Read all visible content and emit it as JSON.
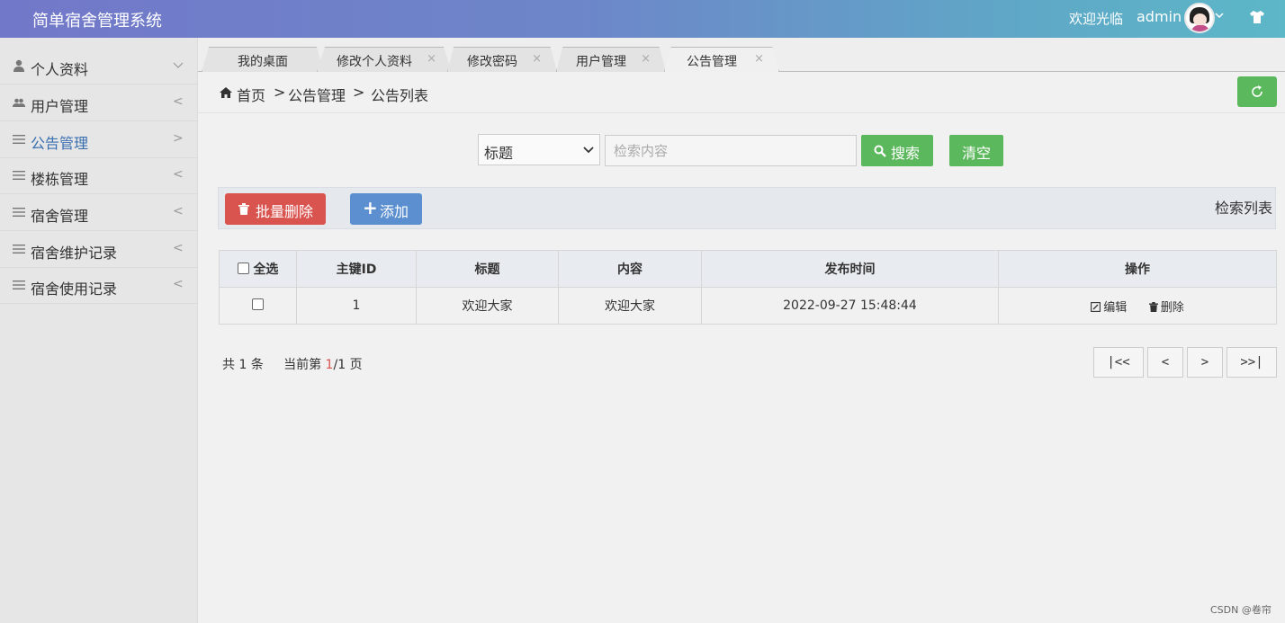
{
  "header": {
    "title": "简单宿舍管理系统",
    "welcome": "欢迎光临",
    "username": "admin"
  },
  "sidebar": {
    "items": [
      {
        "label": "个人资料",
        "arrow": "﹀",
        "icon": "user-icon"
      },
      {
        "label": "用户管理",
        "arrow": "<",
        "icon": "users-icon"
      },
      {
        "label": "公告管理",
        "arrow": ">",
        "icon": "list-icon",
        "active": true
      },
      {
        "label": "楼栋管理",
        "arrow": "<",
        "icon": "list-icon"
      },
      {
        "label": "宿舍管理",
        "arrow": "<",
        "icon": "list-icon"
      },
      {
        "label": "宿舍维护记录",
        "arrow": "<",
        "icon": "list-icon"
      },
      {
        "label": "宿舍使用记录",
        "arrow": "<",
        "icon": "list-icon"
      }
    ]
  },
  "tabs": [
    {
      "label": "我的桌面",
      "closable": false
    },
    {
      "label": "修改个人资料",
      "closable": true
    },
    {
      "label": "修改密码",
      "closable": true
    },
    {
      "label": "用户管理",
      "closable": true
    },
    {
      "label": "公告管理",
      "closable": true,
      "current": true
    }
  ],
  "tab_close": "×",
  "breadcrumb": {
    "home": "首页",
    "sep": ">",
    "level1": "公告管理",
    "level2": "公告列表"
  },
  "search": {
    "field_selected": "标题",
    "placeholder": "检索内容",
    "search_label": "搜索",
    "clear_label": "清空"
  },
  "toolbar": {
    "batch_delete_label": "批量删除",
    "add_label": "添加",
    "list_title": "检索列表"
  },
  "table": {
    "select_all": "全选",
    "columns": [
      "主键ID",
      "标题",
      "内容",
      "发布时间",
      "操作"
    ],
    "rows": [
      {
        "id": "1",
        "title": "欢迎大家",
        "content": "欢迎大家",
        "time": "2022-09-27 15:48:44",
        "edit": "编辑",
        "delete": "删除"
      }
    ]
  },
  "pagination": {
    "total_prefix": "共",
    "total": "1",
    "total_suffix": "条",
    "current_prefix": "当前第",
    "current": "1",
    "sep": "/",
    "pages": "1",
    "pages_suffix": "页",
    "first": "|<<",
    "prev": "<",
    "next": ">",
    "last": ">>|"
  },
  "watermark": "CSDN @卷帘",
  "colors": {
    "success": "#5cb85c",
    "danger": "#d9534f",
    "primary": "#5b8fd0"
  }
}
